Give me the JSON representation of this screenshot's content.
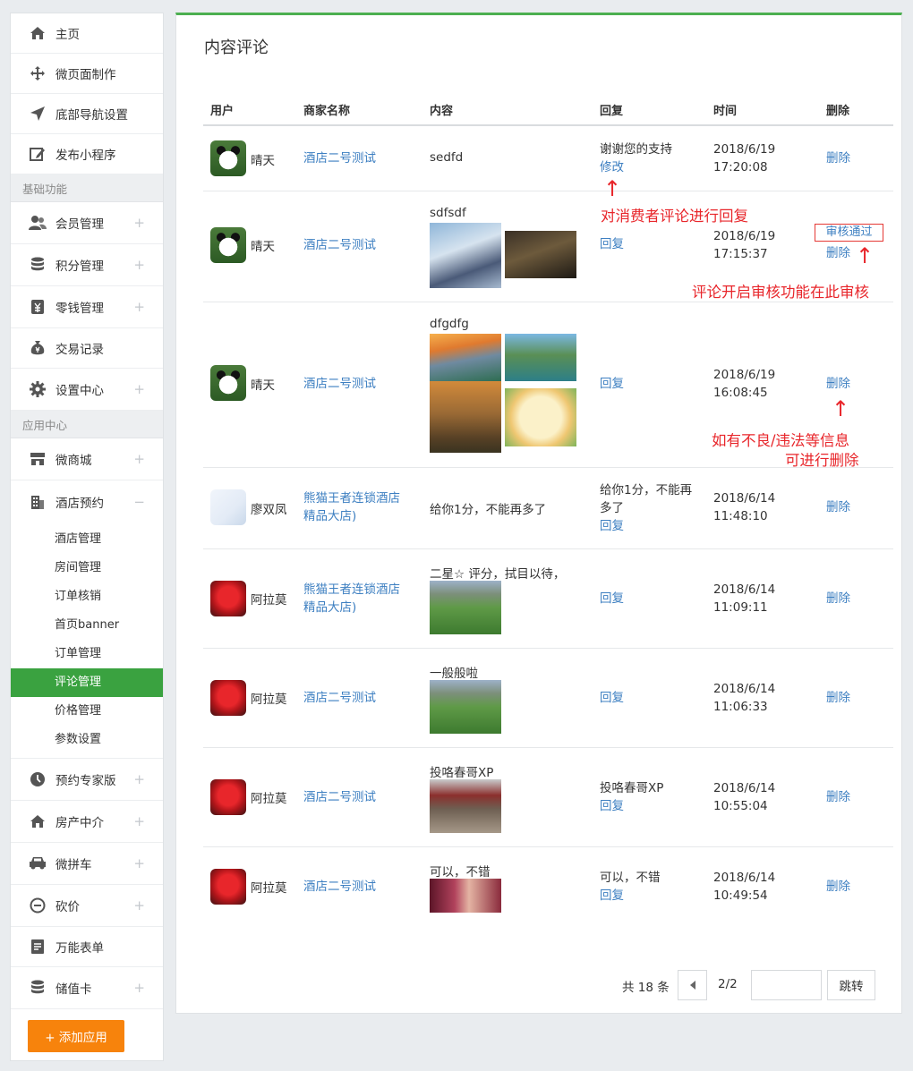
{
  "sidebar": {
    "items_top": [
      {
        "label": "主页",
        "icon": "home-icon"
      },
      {
        "label": "微页面制作",
        "icon": "move-icon"
      },
      {
        "label": "底部导航设置",
        "icon": "navigation-icon"
      },
      {
        "label": "发布小程序",
        "icon": "edit-icon"
      }
    ],
    "section_basic": "基础功能",
    "items_basic": [
      {
        "label": "会员管理",
        "icon": "users-icon",
        "expand": "+"
      },
      {
        "label": "积分管理",
        "icon": "database-icon",
        "expand": "+"
      },
      {
        "label": "零钱管理",
        "icon": "wallet-icon",
        "expand": "+"
      },
      {
        "label": "交易记录",
        "icon": "money-bag-icon",
        "expand": ""
      },
      {
        "label": "设置中心",
        "icon": "gear-icon",
        "expand": "+"
      }
    ],
    "section_apps": "应用中心",
    "item_mall": {
      "label": "微商城",
      "icon": "store-icon",
      "expand": "+"
    },
    "item_hotel": {
      "label": "酒店预约",
      "icon": "building-icon",
      "expand": "−"
    },
    "hotel_sub": [
      "酒店管理",
      "房间管理",
      "订单核销",
      "首页banner",
      "订单管理",
      "评论管理",
      "价格管理",
      "参数设置"
    ],
    "items_apps_after": [
      {
        "label": "预约专家版",
        "icon": "clock-icon",
        "expand": "+"
      },
      {
        "label": "房产中介",
        "icon": "home-icon",
        "expand": "+"
      },
      {
        "label": "微拼车",
        "icon": "car-icon",
        "expand": "+"
      },
      {
        "label": "砍价",
        "icon": "minus-circle-icon",
        "expand": "+"
      },
      {
        "label": "万能表单",
        "icon": "form-icon",
        "expand": ""
      },
      {
        "label": "储值卡",
        "icon": "database-icon",
        "expand": "+"
      }
    ],
    "add_button": "+ 添加应用"
  },
  "main": {
    "title": "内容评论",
    "headers": [
      "用户",
      "商家名称",
      "内容",
      "回复",
      "时间",
      "删除"
    ],
    "rows": [
      {
        "user": "晴天",
        "shop": "酒店二号测试",
        "content": "sedfd",
        "reply_text": "谢谢您的支持",
        "reply_link": "修改",
        "date": "2018/6/19",
        "clock": "17:20:08",
        "delete": "删除"
      },
      {
        "user": "晴天",
        "shop": "酒店二号测试",
        "content": "sdfsdf",
        "reply_text": "",
        "reply_link": "回复",
        "date": "2018/6/19",
        "clock": "17:15:37",
        "approve": "审核通过",
        "delete": "删除"
      },
      {
        "user": "晴天",
        "shop": "酒店二号测试",
        "content": "dfgdfg",
        "reply_text": "",
        "reply_link": "回复",
        "date": "2018/6/19",
        "clock": "16:08:45",
        "delete": "删除"
      },
      {
        "user": "廖双凤",
        "shop": "熊猫王者连锁酒店精品大店)",
        "content": "给你1分，不能再多了",
        "reply_text": "给你1分，不能再多了",
        "reply_link": "回复",
        "date": "2018/6/14",
        "clock": "11:48:10",
        "delete": "删除"
      },
      {
        "user": "阿拉莫",
        "shop": "熊猫王者连锁酒店精品大店)",
        "content": "二星☆ 评分，拭目以待，",
        "reply_text": "",
        "reply_link": "回复",
        "date": "2018/6/14",
        "clock": "11:09:11",
        "delete": "删除"
      },
      {
        "user": "阿拉莫",
        "shop": "酒店二号测试",
        "content": "一般般啦",
        "reply_text": "",
        "reply_link": "回复",
        "date": "2018/6/14",
        "clock": "11:06:33",
        "delete": "删除"
      },
      {
        "user": "阿拉莫",
        "shop": "酒店二号测试",
        "content": "投咯春哥XP",
        "reply_text": "投咯春哥XP",
        "reply_link": "回复",
        "date": "2018/6/14",
        "clock": "10:55:04",
        "delete": "删除"
      },
      {
        "user": "阿拉莫",
        "shop": "酒店二号测试",
        "content": "可以，不错",
        "reply_text": "可以，不错",
        "reply_link": "回复",
        "date": "2018/6/14",
        "clock": "10:49:54",
        "delete": "删除"
      }
    ],
    "annotations": {
      "reply": "对消费者评论进行回复",
      "approve": "评论开启审核功能在此审核",
      "delete_line1": "如有不良/违法等信息",
      "delete_line2": "可进行删除",
      "arrow": "↑"
    },
    "pager": {
      "total": "共 18 条",
      "page": "2/2",
      "go": "跳转",
      "input_value": ""
    }
  },
  "colors": {
    "accent_green": "#3aa240",
    "top_bar": "#4caf50",
    "link": "#3d7fc1",
    "add_button": "#f7830c",
    "annotation": "#e8262b"
  }
}
